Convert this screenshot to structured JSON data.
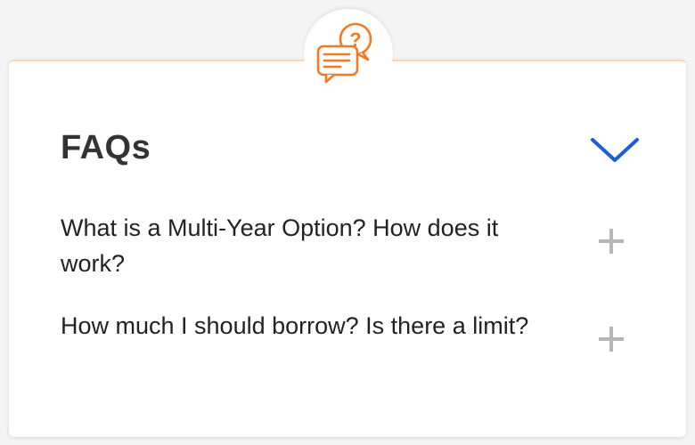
{
  "faq": {
    "title": "FAQs",
    "items": [
      {
        "question": "What is a Multi-Year Option? How does it work?"
      },
      {
        "question": "How much I should borrow? Is there a limit?"
      }
    ]
  },
  "icons": {
    "badge": "chat-question-icon",
    "collapse": "chevron-down-icon",
    "expand": "plus-icon"
  },
  "colors": {
    "accent_orange": "#f47920",
    "accent_blue": "#1a5fd6",
    "plus_gray": "#b7b7b7",
    "title_text": "#333333",
    "card_border_top": "#fbd7ab"
  }
}
